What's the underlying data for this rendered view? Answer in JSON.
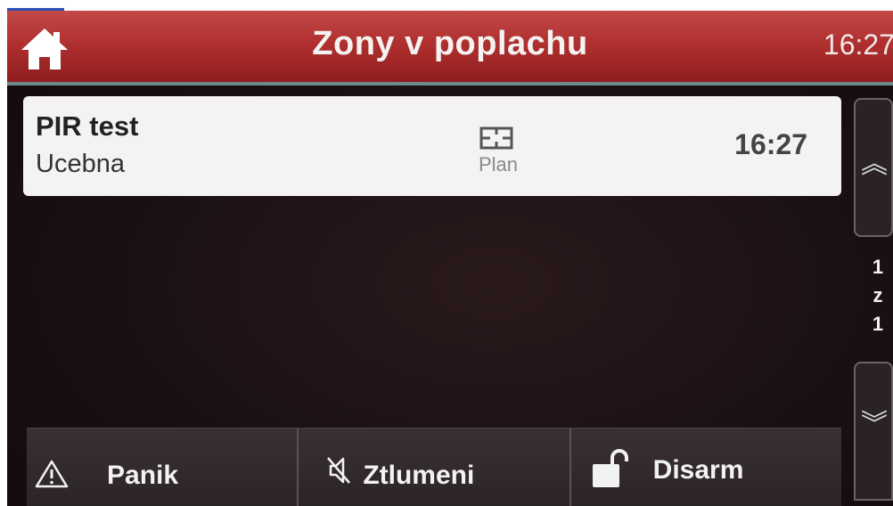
{
  "header": {
    "title": "Zony v poplachu",
    "clock": "16:27"
  },
  "zone": {
    "name": "PIR test",
    "location": "Ucebna",
    "plan_label": "Plan",
    "time": "16:27"
  },
  "pager": {
    "current": "1",
    "separator": "z",
    "total": "1"
  },
  "actions": [
    {
      "label": "Panik",
      "icon": "warning-icon"
    },
    {
      "label": "Ztlumeni",
      "icon": "mute-icon"
    },
    {
      "label": "Disarm",
      "icon": "unlock-icon"
    }
  ],
  "colors": {
    "header_red": "#b0302f",
    "card_bg": "#f4f3f1",
    "screen_bg": "#1a1012"
  }
}
